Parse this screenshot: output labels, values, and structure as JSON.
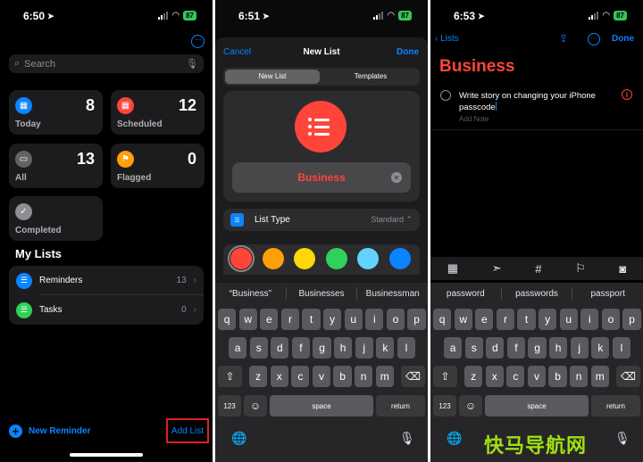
{
  "status": {
    "p1_time": "6:50",
    "p2_time": "6:51",
    "p3_time": "6:53",
    "battery": "87"
  },
  "screen1": {
    "more": "···",
    "search_placeholder": "Search",
    "cards": [
      {
        "label": "Today",
        "count": "8",
        "color": "#0a84ff",
        "icon": "calendar-icon"
      },
      {
        "label": "Scheduled",
        "count": "12",
        "color": "#ff453a",
        "icon": "calendar-icon"
      },
      {
        "label": "All",
        "count": "13",
        "color": "#636366",
        "icon": "tray-icon"
      },
      {
        "label": "Flagged",
        "count": "0",
        "color": "#ff9f0a",
        "icon": "flag-icon"
      },
      {
        "label": "Completed",
        "color": "#8e8e93",
        "icon": "checkmark-icon"
      }
    ],
    "my_lists_title": "My Lists",
    "lists": [
      {
        "name": "Reminders",
        "count": "13",
        "color": "#0a84ff"
      },
      {
        "name": "Tasks",
        "count": "0",
        "color": "#30d158"
      }
    ],
    "new_reminder": "New Reminder",
    "add_list": "Add List"
  },
  "screen2": {
    "cancel": "Cancel",
    "title": "New List",
    "done": "Done",
    "tabs": [
      "New List",
      "Templates"
    ],
    "list_name": "Business",
    "list_type_label": "List Type",
    "list_type_value": "Standard",
    "colors": [
      "#ff453a",
      "#ff9f0a",
      "#ffd60a",
      "#30d158",
      "#64d2ff",
      "#0a84ff"
    ],
    "suggestions": [
      "“Business”",
      "Businesses",
      "Businessman"
    ]
  },
  "screen3": {
    "back": "Lists",
    "done": "Done",
    "title": "Business",
    "reminder_text": "Write story on changing your iPhone passcode",
    "add_note": "Add Note",
    "suggestions": [
      "password",
      "passwords",
      "passport"
    ]
  },
  "keyboard": {
    "row1": [
      "q",
      "w",
      "e",
      "r",
      "t",
      "y",
      "u",
      "i",
      "o",
      "p"
    ],
    "row2": [
      "a",
      "s",
      "d",
      "f",
      "g",
      "h",
      "j",
      "k",
      "l"
    ],
    "row3": [
      "z",
      "x",
      "c",
      "v",
      "b",
      "n",
      "m"
    ],
    "numbers": "123",
    "space": "space",
    "return": "return"
  },
  "watermark": "快马导航网"
}
